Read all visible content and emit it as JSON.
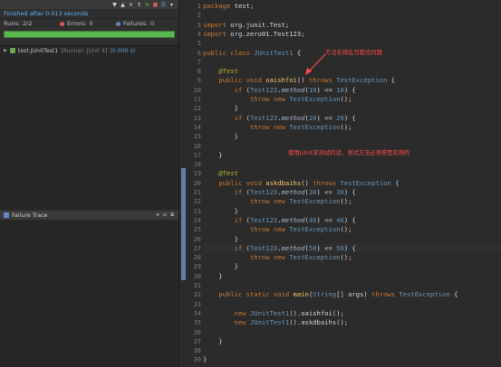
{
  "junit": {
    "status": "Finished after 0.013 seconds",
    "runs_label": "Runs:",
    "runs_value": "2/2",
    "errors_label": "Errors:",
    "errors_value": "0",
    "failures_label": "Failures:",
    "failures_value": "0",
    "progress": 1.0,
    "progress_color": "#5bb651",
    "tree": [
      {
        "name": "test.JUnitTest1",
        "runner": "[Runner: JUnit 4]",
        "time": "(0.000 s)"
      }
    ],
    "failure_trace_label": "Failure Trace"
  },
  "editor": {
    "annotations": [
      "方法名称乱写都没问题",
      "使用JUnit來测试的话，测试方法必须得是实例的"
    ],
    "lines": [
      {
        "n": "1",
        "html": "<span class=\"kw\">package</span> test;"
      },
      {
        "n": "2",
        "html": ""
      },
      {
        "n": "3",
        "html": "<span class=\"kw\">import</span> org.junit.Test;"
      },
      {
        "n": "4",
        "html": "<span class=\"kw\">import</span> org.zero01.Test123;"
      },
      {
        "n": "5",
        "html": ""
      },
      {
        "n": "6",
        "html": "<span class=\"kw\">public class</span> <span class=\"ty\">JUnitTest1</span> {"
      },
      {
        "n": "7",
        "html": ""
      },
      {
        "n": "8",
        "html": "    <span class=\"ann\">@Test</span>"
      },
      {
        "n": "9",
        "html": "    <span class=\"kw\">public void</span> <span class=\"fn\">oaishfoi</span>() <span class=\"kw\">throws</span> <span class=\"ty\">TestException</span> {"
      },
      {
        "n": "10",
        "html": "        <span class=\"kw\">if</span> (<span class=\"ty\">Test123</span>.<span class=\"mth\">method</span>(<span class=\"num\">10</span>) <= <span class=\"num\">10</span>) {"
      },
      {
        "n": "11",
        "html": "            <span class=\"kw\">throw new</span> <span class=\"ty\">TestException</span>();"
      },
      {
        "n": "12",
        "html": "        }"
      },
      {
        "n": "13",
        "html": "        <span class=\"kw\">if</span> (<span class=\"ty\">Test123</span>.<span class=\"mth\">method</span>(<span class=\"num\">20</span>) <= <span class=\"num\">20</span>) {"
      },
      {
        "n": "14",
        "html": "            <span class=\"kw\">throw new</span> <span class=\"ty\">TestException</span>();"
      },
      {
        "n": "15",
        "html": "        }"
      },
      {
        "n": "16",
        "html": ""
      },
      {
        "n": "17",
        "html": "    }"
      },
      {
        "n": "18",
        "html": ""
      },
      {
        "n": "19",
        "html": "    <span class=\"ann\">@Test</span>"
      },
      {
        "n": "20",
        "html": "    <span class=\"kw\">public void</span> <span class=\"fn\">askdbaihs</span>() <span class=\"kw\">throws</span> <span class=\"ty\">TestException</span> {"
      },
      {
        "n": "21",
        "html": "        <span class=\"kw\">if</span> (<span class=\"ty\">Test123</span>.<span class=\"mth\">method</span>(<span class=\"num\">30</span>) <= <span class=\"num\">30</span>) {"
      },
      {
        "n": "22",
        "html": "            <span class=\"kw\">throw new</span> <span class=\"ty\">TestException</span>();"
      },
      {
        "n": "23",
        "html": "        }"
      },
      {
        "n": "24",
        "html": "        <span class=\"kw\">if</span> (<span class=\"ty\">Test123</span>.<span class=\"mth\">method</span>(<span class=\"num\">40</span>) <= <span class=\"num\">40</span>) {"
      },
      {
        "n": "25",
        "html": "            <span class=\"kw\">throw new</span> <span class=\"ty\">TestException</span>();"
      },
      {
        "n": "26",
        "html": "        }"
      },
      {
        "n": "27",
        "html": "        <span class=\"kw\">if</span> (<span class=\"ty\">Test123</span>.<span class=\"mth\">method</span>(<span class=\"num\">50</span>) <= <span class=\"num\">50</span>) {"
      },
      {
        "n": "28",
        "html": "            <span class=\"kw\">throw new</span> <span class=\"ty\">TestException</span>();"
      },
      {
        "n": "29",
        "html": "        }"
      },
      {
        "n": "30",
        "html": "    }"
      },
      {
        "n": "31",
        "html": ""
      },
      {
        "n": "32",
        "html": "    <span class=\"kw\">public static void</span> <span class=\"fn\">main</span>(<span class=\"ty\">String</span>[] args) <span class=\"kw\">throws</span> <span class=\"ty\">TestException</span> {"
      },
      {
        "n": "33",
        "html": ""
      },
      {
        "n": "34",
        "html": "        <span class=\"kw\">new</span> <span class=\"ty\">JUnitTest1</span>().oaishfoi();"
      },
      {
        "n": "35",
        "html": "        <span class=\"kw\">new</span> <span class=\"ty\">JUnitTest1</span>().askdbaihs();"
      },
      {
        "n": "36",
        "html": ""
      },
      {
        "n": "37",
        "html": "    }"
      },
      {
        "n": "38",
        "html": ""
      },
      {
        "n": "39",
        "html": "}"
      }
    ]
  }
}
